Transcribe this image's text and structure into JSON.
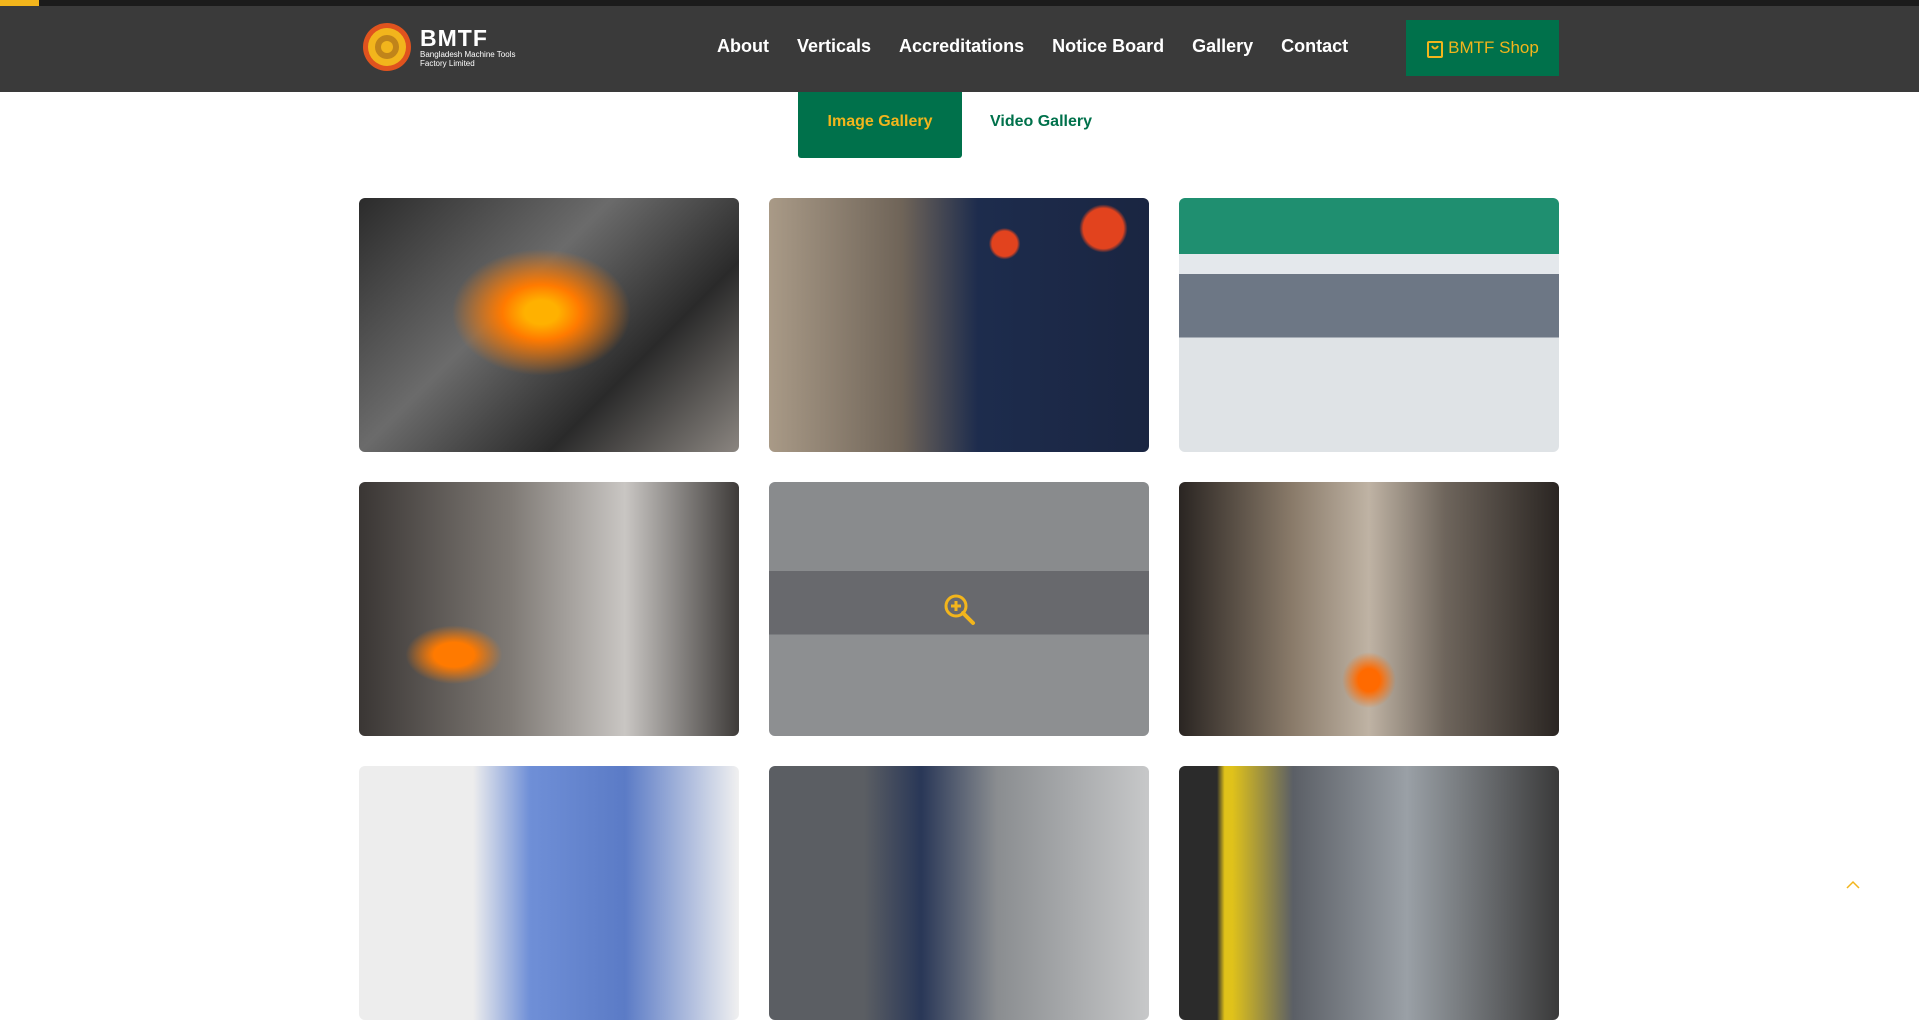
{
  "brand": {
    "name": "BMTF",
    "subtitle": "Bangladesh Machine Tools Factory Limited",
    "accent": "#f2b51c",
    "primary": "#00714b",
    "header_bg": "#3a3a3a"
  },
  "nav": {
    "items": [
      {
        "label": "About"
      },
      {
        "label": "Verticals"
      },
      {
        "label": "Accreditations"
      },
      {
        "label": "Notice Board"
      },
      {
        "label": "Gallery"
      },
      {
        "label": "Contact"
      }
    ],
    "shop_label": "BMTF Shop",
    "shop_icon": "shopping-bag-icon"
  },
  "tabs": {
    "image_label": "Image Gallery",
    "video_label": "Video Gallery",
    "active": "Image Gallery"
  },
  "gallery": {
    "hovered_index": 4,
    "hover_icon": "zoom-in-icon",
    "items": [
      {
        "subject": "molten-metal-pouring"
      },
      {
        "subject": "workers-casting"
      },
      {
        "subject": "factory-floor"
      },
      {
        "subject": "press-forging"
      },
      {
        "subject": "assembly-line"
      },
      {
        "subject": "drop-hammer"
      },
      {
        "subject": "lab-workers"
      },
      {
        "subject": "lathe-operator"
      },
      {
        "subject": "machine-shop"
      }
    ]
  },
  "scroll_top_icon": "chevron-up-icon"
}
